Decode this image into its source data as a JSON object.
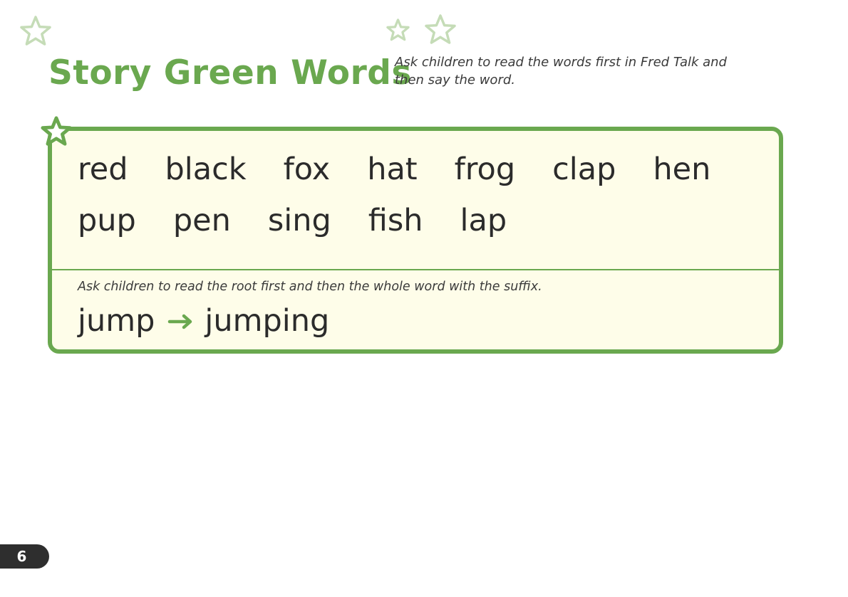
{
  "header": {
    "title": "Story Green Words",
    "instruction": "Ask children to read the words first in Fred Talk and then say the word."
  },
  "words": {
    "row1": [
      "red",
      "black",
      "fox",
      "hat",
      "frog",
      "clap",
      "hen"
    ],
    "row2": [
      "pup",
      "pen",
      "sing",
      "fish",
      "lap"
    ]
  },
  "suffix": {
    "instruction": "Ask children to read the root first and then the whole word with the suffix.",
    "root": "jump",
    "word": "jumping"
  },
  "page_number": "6",
  "colors": {
    "accent_green": "#6aa84f",
    "light_green": "#c5dcb7",
    "box_fill": "#fefde9",
    "page_tab": "#2e2e2e"
  },
  "icons": [
    "star-outline-icon",
    "star-filled-corner-icon",
    "right-arrow-icon"
  ]
}
